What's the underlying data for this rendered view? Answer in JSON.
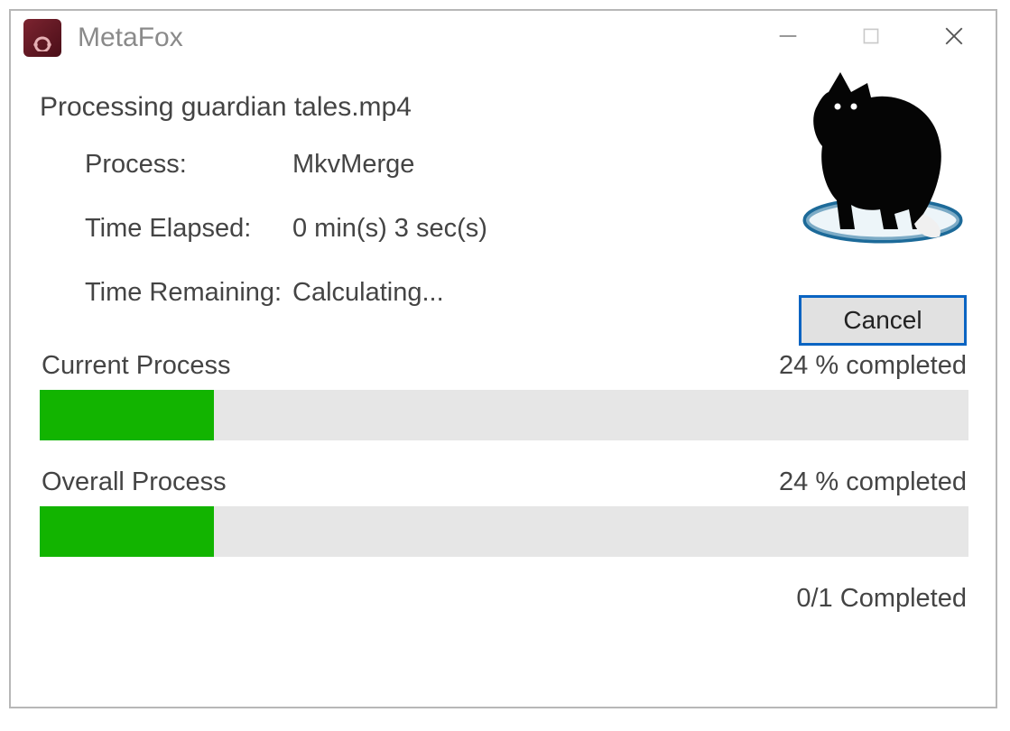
{
  "titlebar": {
    "app_name": "MetaFox"
  },
  "status": {
    "heading": "Processing guardian tales.mp4",
    "process_label": "Process:",
    "process_value": "MkvMerge",
    "elapsed_label": "Time Elapsed:",
    "elapsed_value": "0 min(s) 3 sec(s)",
    "remaining_label": "Time Remaining:",
    "remaining_value": "Calculating..."
  },
  "cancel_label": "Cancel",
  "progress": {
    "current_label": "Current Process",
    "current_percent_text": "24 % completed",
    "current_percent": 24,
    "overall_label": "Overall Process",
    "overall_percent_text": "24 % completed",
    "overall_percent": 24,
    "count_text": "0/1 Completed"
  },
  "colors": {
    "progress_fill": "#12b400",
    "cancel_border": "#0a64c2"
  }
}
